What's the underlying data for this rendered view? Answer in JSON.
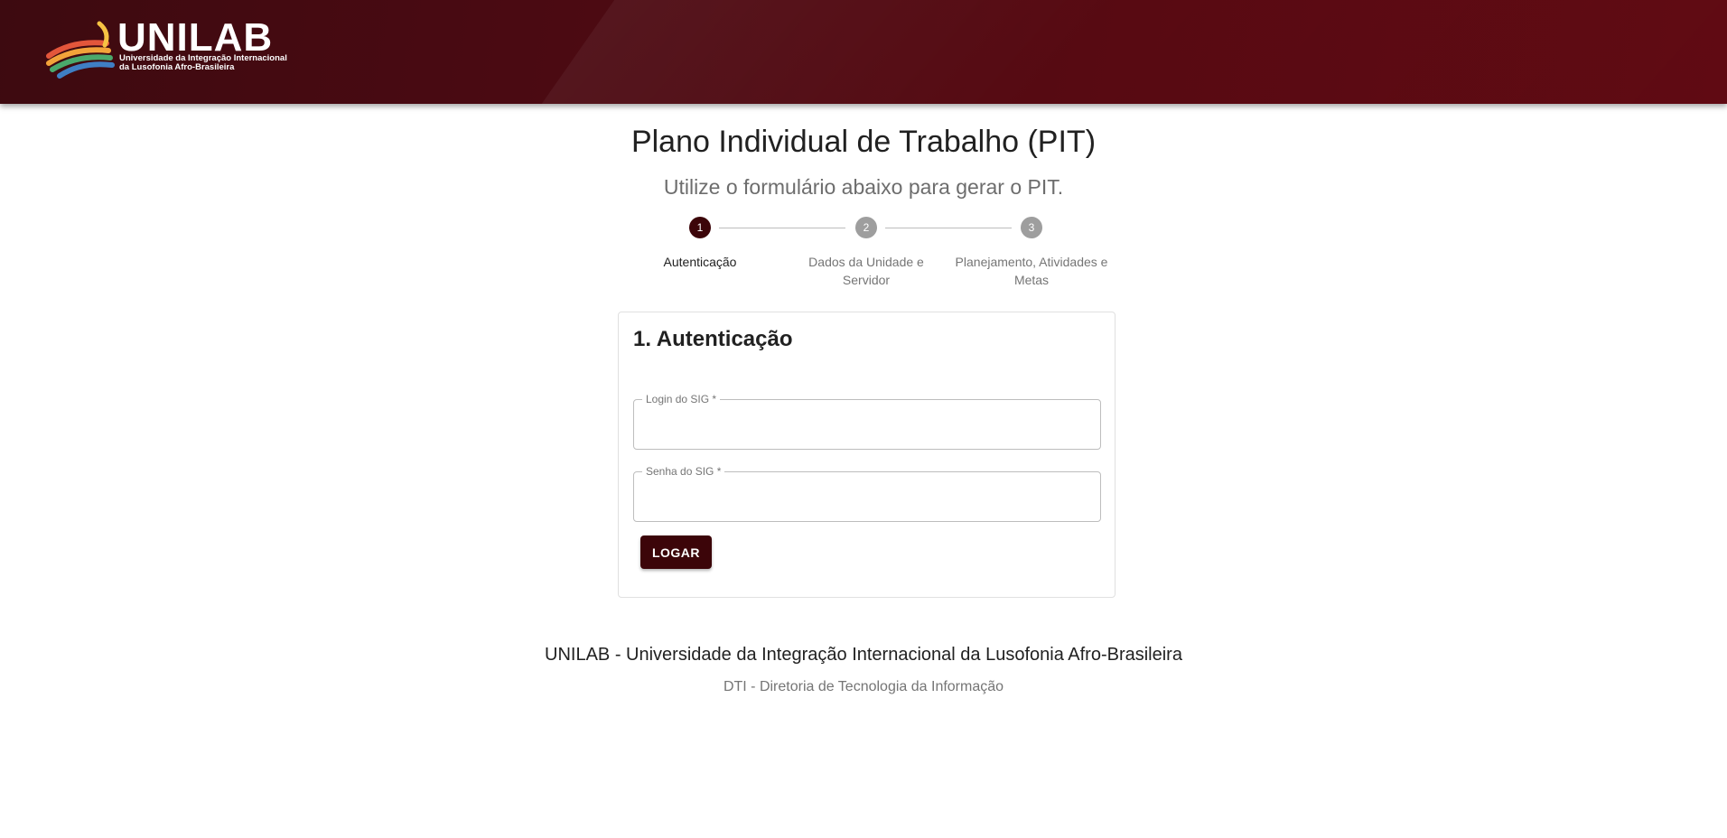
{
  "header": {
    "logo_word": "UNILAB",
    "logo_sub_line1": "Universidade da Integração Internacional",
    "logo_sub_line2": "da Lusofonia Afro-Brasileira"
  },
  "page": {
    "title": "Plano Individual de Trabalho (PIT)",
    "subtitle": "Utilize o formulário abaixo para gerar o PIT."
  },
  "stepper": {
    "steps": [
      {
        "number": "1",
        "label": "Autenticação",
        "active": true
      },
      {
        "number": "2",
        "label": "Dados da Unidade e Servidor",
        "active": false
      },
      {
        "number": "3",
        "label": "Planejamento, Atividades e Metas",
        "active": false
      }
    ]
  },
  "form": {
    "title": "1. Autenticação",
    "login_label": "Login do SIG *",
    "login_value": "",
    "password_label": "Senha do SIG *",
    "password_value": "",
    "submit_label": "LOGAR"
  },
  "footer": {
    "main": "UNILAB - Universidade da Integração Internacional da Lusofonia Afro-Brasileira",
    "sub": "DTI - Diretoria de Tecnologia da Informação"
  },
  "colors": {
    "brand": "#3c0509",
    "header": "#560a12",
    "inactive_step": "#9e9e9e"
  }
}
